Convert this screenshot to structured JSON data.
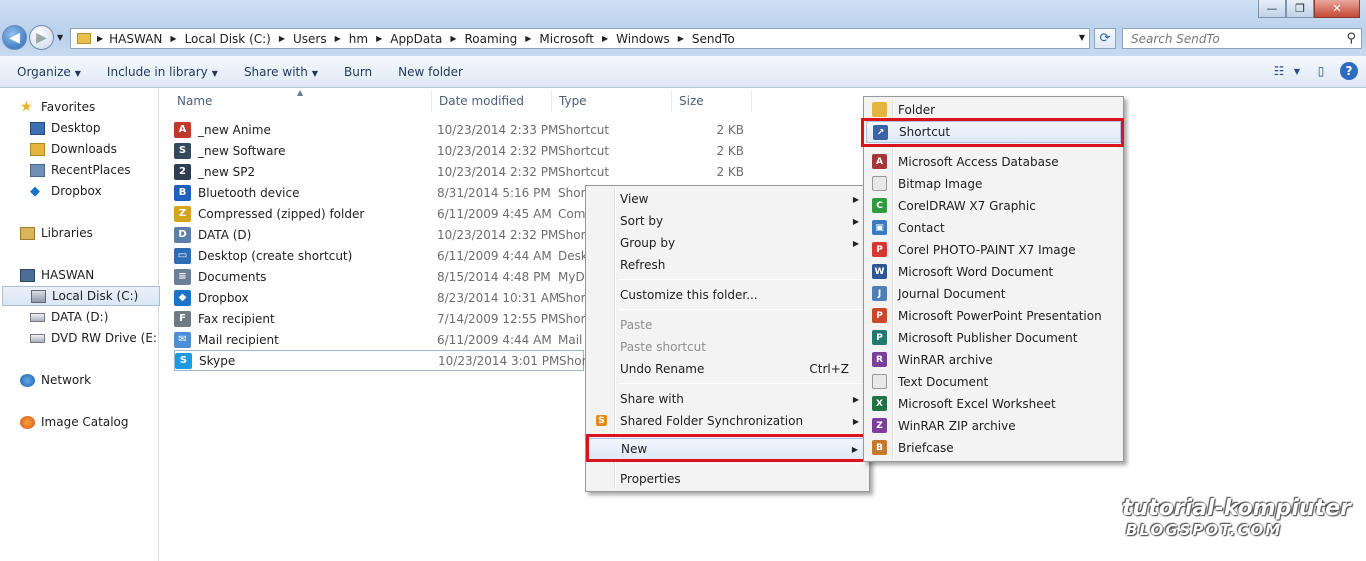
{
  "window": {
    "buttons": [
      "—",
      "❐",
      "✕"
    ]
  },
  "address": {
    "crumbs": [
      "HASWAN",
      "Local Disk (C:)",
      "Users",
      "hm",
      "AppData",
      "Roaming",
      "Microsoft",
      "Windows",
      "SendTo"
    ]
  },
  "search": {
    "placeholder": "Search SendTo"
  },
  "toolbar": {
    "items": [
      "Organize",
      "Include in library",
      "Share with",
      "Burn",
      "New folder"
    ]
  },
  "nav": {
    "favorites": "Favorites",
    "fav_items": [
      "Desktop",
      "Downloads",
      "RecentPlaces",
      "Dropbox"
    ],
    "libraries": "Libraries",
    "computer": "HASWAN",
    "drives": [
      "Local Disk (C:)",
      "DATA (D:)",
      "DVD RW Drive (E:) RI"
    ],
    "network": "Network",
    "image_catalog": "Image Catalog"
  },
  "columns": [
    "Name",
    "Date modified",
    "Type",
    "Size"
  ],
  "files": [
    {
      "name": "_new Anime",
      "date": "10/23/2014 2:33 PM",
      "type": "Shortcut",
      "size": "2 KB",
      "color": "#c0392b",
      "glyph": "A"
    },
    {
      "name": "_new Software",
      "date": "10/23/2014 2:32 PM",
      "type": "Shortcut",
      "size": "2 KB",
      "color": "#34495e",
      "glyph": "S"
    },
    {
      "name": "_new SP2",
      "date": "10/23/2014 2:32 PM",
      "type": "Shortcut",
      "size": "2 KB",
      "color": "#2c3e50",
      "glyph": "2"
    },
    {
      "name": "Bluetooth device",
      "date": "8/31/2014 5:16 PM",
      "type": "Short",
      "size": "",
      "color": "#1f5fbf",
      "glyph": "B"
    },
    {
      "name": "Compressed (zipped) folder",
      "date": "6/11/2009 4:45 AM",
      "type": "Com",
      "size": "",
      "color": "#d6a520",
      "glyph": "Z"
    },
    {
      "name": "DATA (D)",
      "date": "10/23/2014 2:32 PM",
      "type": "Short",
      "size": "",
      "color": "#5b7fa8",
      "glyph": "D"
    },
    {
      "name": "Desktop (create shortcut)",
      "date": "6/11/2009 4:44 AM",
      "type": "Deskt",
      "size": "",
      "color": "#2e6db4",
      "glyph": "▭"
    },
    {
      "name": "Documents",
      "date": "8/15/2014 4:48 PM",
      "type": "MyDo",
      "size": "",
      "color": "#6a7f99",
      "glyph": "≡"
    },
    {
      "name": "Dropbox",
      "date": "8/23/2014 10:31 AM",
      "type": "Short",
      "size": "",
      "color": "#1a73c9",
      "glyph": "◆"
    },
    {
      "name": "Fax recipient",
      "date": "7/14/2009 12:55 PM",
      "type": "Short",
      "size": "",
      "color": "#6d7b86",
      "glyph": "F"
    },
    {
      "name": "Mail recipient",
      "date": "6/11/2009 4:44 AM",
      "type": "Mail",
      "size": "",
      "color": "#4c8fd6",
      "glyph": "✉"
    },
    {
      "name": "Skype",
      "date": "10/23/2014 3:01 PM",
      "type": "Short",
      "size": "",
      "color": "#1b9be0",
      "glyph": "S"
    }
  ],
  "context_menu": {
    "items": [
      {
        "label": "View",
        "sub": true
      },
      {
        "label": "Sort by",
        "sub": true
      },
      {
        "label": "Group by",
        "sub": true
      },
      {
        "label": "Refresh"
      },
      {
        "label": "Customize this folder..."
      },
      {
        "label": "Paste",
        "disabled": true
      },
      {
        "label": "Paste shortcut",
        "disabled": true
      },
      {
        "label": "Undo Rename",
        "accel": "Ctrl+Z"
      },
      {
        "label": "Share with",
        "sub": true
      },
      {
        "label": "Shared Folder Synchronization",
        "sub": true
      },
      {
        "label": "New",
        "sub": true
      },
      {
        "label": "Properties"
      }
    ]
  },
  "new_menu": {
    "items": [
      {
        "label": "Folder",
        "color": "#e3b53c",
        "glyph": ""
      },
      {
        "label": "Shortcut",
        "color": "#3b63a8",
        "glyph": "↗"
      },
      {
        "label": "Microsoft Access Database",
        "color": "#a4373a",
        "glyph": "A"
      },
      {
        "label": "Bitmap Image",
        "color": "#e8e8e8",
        "glyph": ""
      },
      {
        "label": "CorelDRAW X7 Graphic",
        "color": "#2f9a3f",
        "glyph": "C"
      },
      {
        "label": "Contact",
        "color": "#3a7bbf",
        "glyph": "▣"
      },
      {
        "label": "Corel PHOTO-PAINT X7 Image",
        "color": "#d6362f",
        "glyph": "P"
      },
      {
        "label": "Microsoft Word Document",
        "color": "#2b5797",
        "glyph": "W"
      },
      {
        "label": "Journal Document",
        "color": "#4e7fb5",
        "glyph": "J"
      },
      {
        "label": "Microsoft PowerPoint Presentation",
        "color": "#c9472b",
        "glyph": "P"
      },
      {
        "label": "Microsoft Publisher Document",
        "color": "#1f7a6d",
        "glyph": "P"
      },
      {
        "label": "WinRAR archive",
        "color": "#7b3f99",
        "glyph": "R"
      },
      {
        "label": "Text Document",
        "color": "#e8e8e8",
        "glyph": ""
      },
      {
        "label": "Microsoft Excel Worksheet",
        "color": "#217346",
        "glyph": "X"
      },
      {
        "label": "WinRAR ZIP archive",
        "color": "#7b3f99",
        "glyph": "Z"
      },
      {
        "label": "Briefcase",
        "color": "#c47a2a",
        "glyph": "B"
      }
    ]
  },
  "watermark": {
    "line1": "tutorial-kompiuter",
    "line2": "BLOGSPOT.COM"
  },
  "colors": {
    "highlight_red": "#d9141f",
    "selection_blue": "#a8c3e6"
  }
}
